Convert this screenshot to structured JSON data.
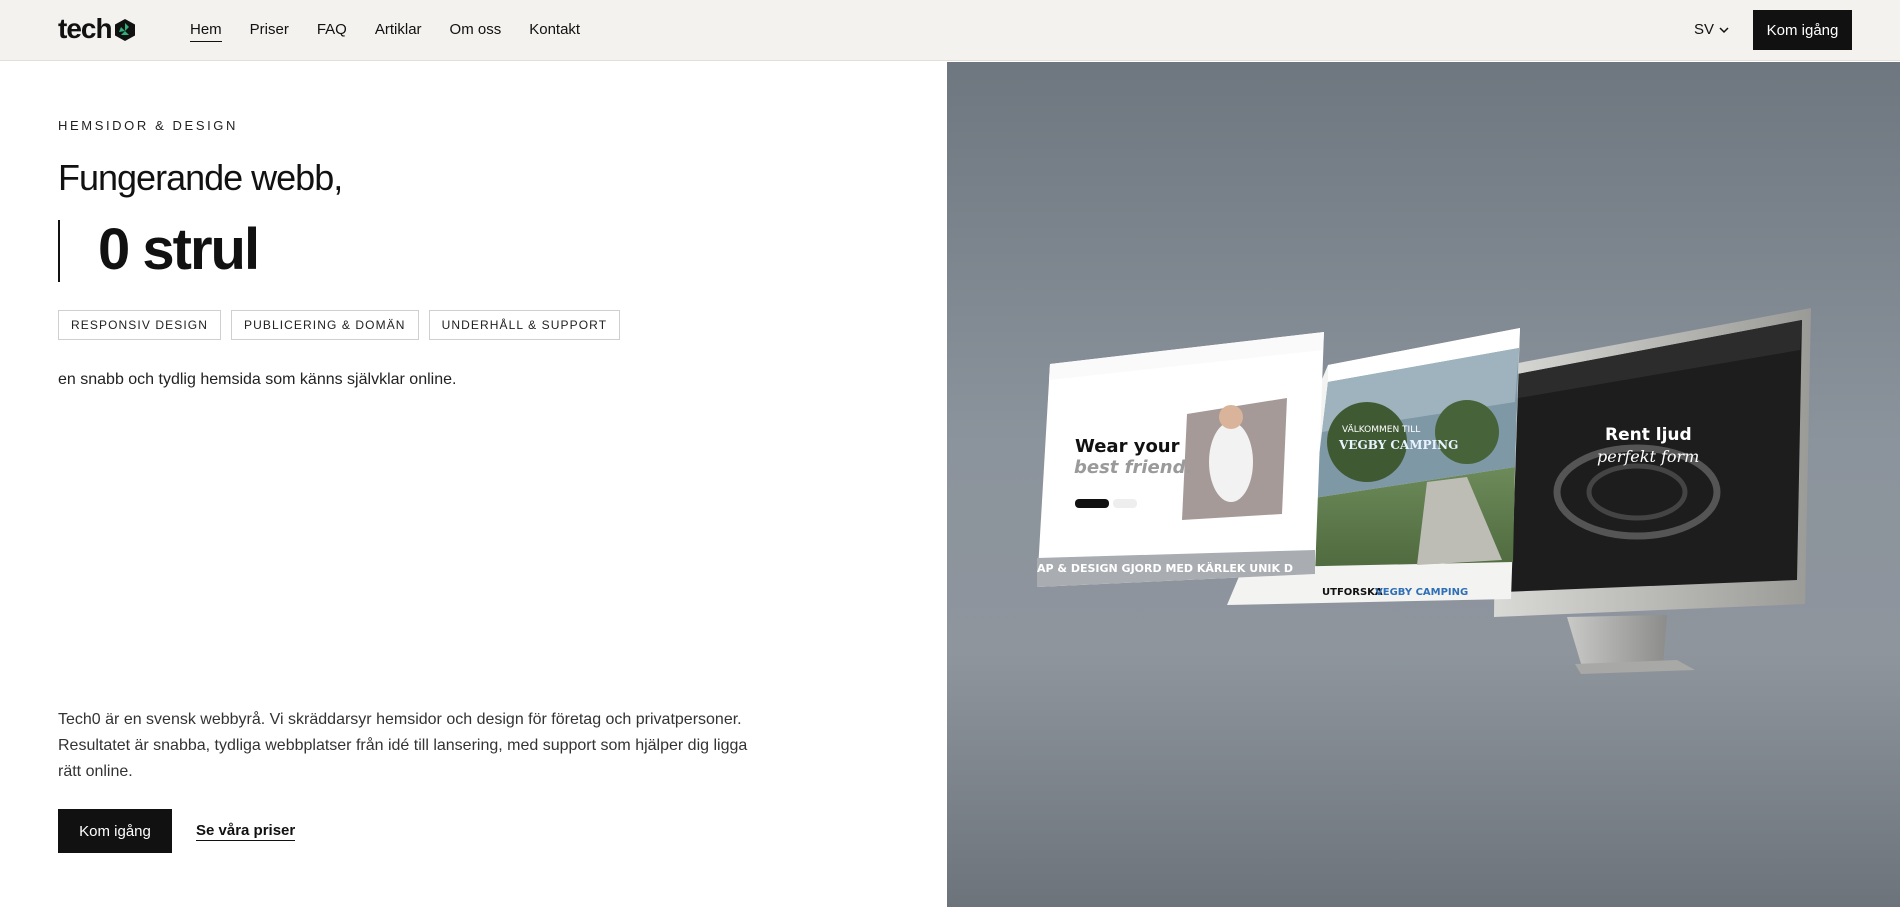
{
  "header": {
    "logo_text": "tech",
    "nav": [
      {
        "label": "Hem",
        "active": true
      },
      {
        "label": "Priser"
      },
      {
        "label": "FAQ"
      },
      {
        "label": "Artiklar"
      },
      {
        "label": "Om oss"
      },
      {
        "label": "Kontakt"
      }
    ],
    "language": "SV",
    "cta_label": "Kom igång"
  },
  "hero": {
    "eyebrow": "HEMSIDOR & DESIGN",
    "headline_line1": "Fungerande webb,",
    "headline_line2": "0 strul",
    "tags": [
      "RESPONSIV DESIGN",
      "PUBLICERING & DOMÄN",
      "UNDERHÅLL & SUPPORT"
    ],
    "lead": "en snabb och tydlig hemsida som känns självklar online.",
    "about": "Tech0 är en svensk webbyrå. Vi skräddarsyr hemsidor och design för företag och privatpersoner. Resultatet är snabba, tydliga webbplatser från idé till lansering, med support som hjälper dig ligga rätt online.",
    "primary_cta": "Kom igång",
    "secondary_cta": "Se våra priser"
  },
  "mockups": {
    "screen1_headline_a": "Wear your",
    "screen1_headline_b": "best friend.",
    "screen1_footer": "AP & DESIGN   GJORD MED KÄRLEK   UNIK D",
    "screen2_title_a": "VÄLKOMMEN TILL",
    "screen2_title_b": "VEGBY CAMPING",
    "screen2_footer_a": "UTFORSKA",
    "screen2_footer_b": "VEGBY CAMPING",
    "screen3_headline_a": "Rent ljud",
    "screen3_headline_b": "perfekt form"
  },
  "colors": {
    "brand_dark": "#111111",
    "logo_accent": "#1f8a5a",
    "hero_bg": "#838b94",
    "camping_blue": "#2f6fb5"
  }
}
